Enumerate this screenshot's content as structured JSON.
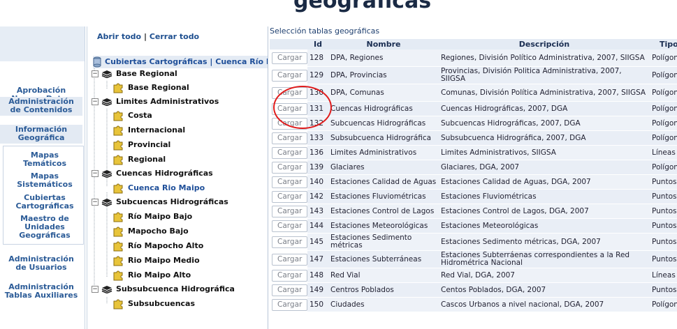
{
  "banner": {
    "title": "geográficas"
  },
  "nav": {
    "items": [
      {
        "label_1": "Aprobación",
        "label_2": "Nuevos Datos"
      },
      {
        "label_1": "Administración",
        "label_2": "de Contenidos"
      },
      {
        "label_1": "Información",
        "label_2": "Geográfica"
      },
      {
        "label_1": "Administración",
        "label_2": "de Usuarios"
      },
      {
        "label_1": "Administración",
        "label_2": "Tablas Auxiliares"
      }
    ],
    "sub_items": [
      {
        "label_1": "Mapas",
        "label_2": "Temáticos"
      },
      {
        "label_1": "Mapas",
        "label_2": "Sistemáticos"
      },
      {
        "label_1": "Cubiertas",
        "label_2": "Cartográficas"
      },
      {
        "label_1": "Maestro de",
        "label_2": "Unidades",
        "label_3": "Geográficas"
      }
    ]
  },
  "tree": {
    "open_all": "Abrir todo",
    "separator": "|",
    "close_all": "Cerrar todo",
    "root": "Cubiertas Cartográficas | Cuenca Río M",
    "groups": [
      {
        "label": "Base Regional",
        "children": [
          "Base Regional"
        ]
      },
      {
        "label": "Limites Administrativos",
        "children": [
          "Costa",
          "Internacional",
          "Provincial",
          "Regional"
        ]
      },
      {
        "label": "Cuencas Hidrográficas",
        "children": [
          "Cuenca Rio Maipo"
        ]
      },
      {
        "label": "Subcuencas Hidrográficas",
        "children": [
          "Río Maipo Bajo",
          "Mapocho Bajo",
          "Río Mapocho Alto",
          "Rio Maipo Medio",
          "Rio Maipo Alto"
        ]
      },
      {
        "label": "Subsubcuenca Hidrográfica",
        "children": [
          "Subsubcuencas"
        ]
      }
    ]
  },
  "content": {
    "title": "Selección tablas geográficas",
    "button_label": "Cargar",
    "columns": [
      "",
      "Id",
      "Nombre",
      "Descripción",
      "Tipo"
    ],
    "rows": [
      {
        "id": "128",
        "nombre": "DPA, Regiones",
        "descripcion": "Regiones, División Político Administrativa, 2007, SIIGSA",
        "tipo": "Polígonos"
      },
      {
        "id": "129",
        "nombre": "DPA, Provincias",
        "descripcion": "Provincias, División Politica Administrativa, 2007, SIIGSA",
        "tipo": "Polígonos"
      },
      {
        "id": "130",
        "nombre": "DPA, Comunas",
        "descripcion": "Comunas, División Política Administrativa, 2007, SIIGSA",
        "tipo": "Polígonos"
      },
      {
        "id": "131",
        "nombre": "Cuencas Hidrográficas",
        "descripcion": "Cuencas Hidrográficas, 2007, DGA",
        "tipo": "Polígonos"
      },
      {
        "id": "132",
        "nombre": "Subcuencas Hidrográficas",
        "descripcion": "Subcuencas Hidrográficas, 2007, DGA",
        "tipo": "Polígonos"
      },
      {
        "id": "133",
        "nombre": "Subsubcuenca Hidrográfica",
        "descripcion": "Subsubcuenca Hidrográfica, 2007, DGA",
        "tipo": "Polígonos"
      },
      {
        "id": "136",
        "nombre": "Limites Administrativos",
        "descripcion": "Limites Administrativos, SIIGSA",
        "tipo": "Líneas"
      },
      {
        "id": "139",
        "nombre": "Glaciares",
        "descripcion": "Glaciares, DGA, 2007",
        "tipo": "Polígonos"
      },
      {
        "id": "140",
        "nombre": "Estaciones Calidad de Aguas",
        "descripcion": "Estaciones Calidad de Aguas, DGA, 2007",
        "tipo": "Puntos"
      },
      {
        "id": "142",
        "nombre": "Estaciones Fluviométricas",
        "descripcion": "Estaciones Fluviométricas",
        "tipo": "Puntos"
      },
      {
        "id": "143",
        "nombre": "Estaciones Control de Lagos",
        "descripcion": "Estaciones Control de Lagos, DGA, 2007",
        "tipo": "Puntos"
      },
      {
        "id": "144",
        "nombre": "Estaciones Meteorológicas",
        "descripcion": "Estaciones Meteorológicas",
        "tipo": "Puntos"
      },
      {
        "id": "145",
        "nombre": "Estaciones Sedimento métricas",
        "descripcion": "Estaciones Sedimento métricas, DGA, 2007",
        "tipo": "Puntos"
      },
      {
        "id": "147",
        "nombre": "Estaciones Subterráneas",
        "descripcion": "Estaciones Subterráenas correspondientes a la Red Hidrométrica Nacional",
        "tipo": "Puntos"
      },
      {
        "id": "148",
        "nombre": "Red Vial",
        "descripcion": "Red Vial, DGA, 2007",
        "tipo": "Líneas"
      },
      {
        "id": "149",
        "nombre": "Centros Poblados",
        "descripcion": "Centos Poblados, DGA, 2007",
        "tipo": "Puntos"
      },
      {
        "id": "150",
        "nombre": "Ciudades",
        "descripcion": "Cascos Urbanos a nivel nacional, DGA, 2007",
        "tipo": "Polígonos"
      }
    ]
  },
  "colors": {
    "accent": "#2b5b97",
    "header_bg": "#e4ebf4",
    "highlight_circle": "#e01b1b"
  }
}
